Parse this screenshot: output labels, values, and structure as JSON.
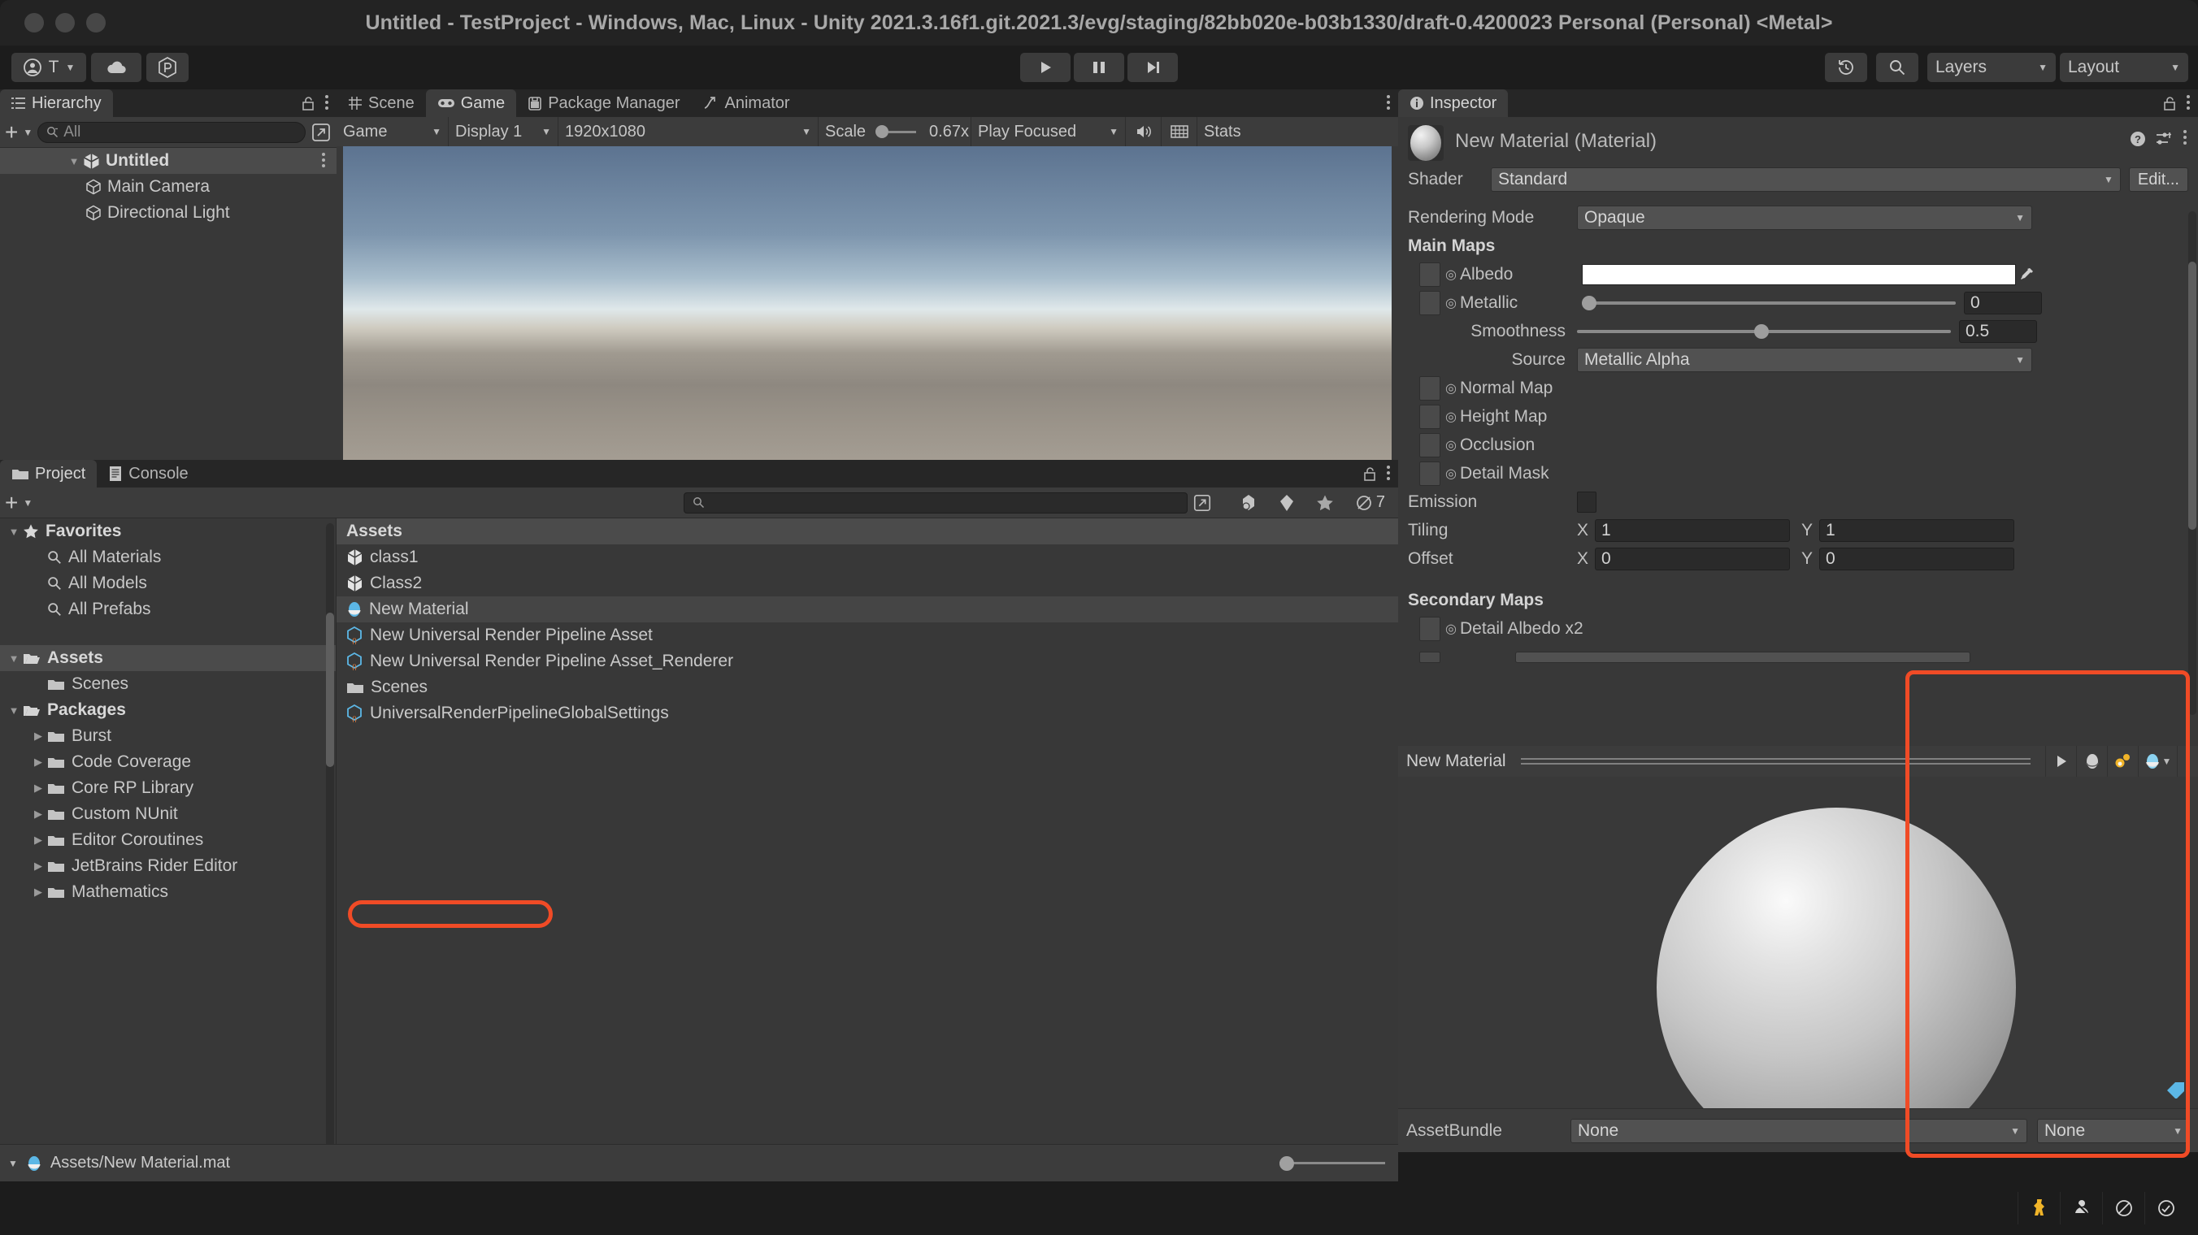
{
  "window": {
    "title": "Untitled - TestProject - Windows, Mac, Linux - Unity 2021.3.16f1.git.2021.3/evg/staging/82bb020e-b03b1330/draft-0.4200023 Personal (Personal) <Metal>"
  },
  "toolbar": {
    "account_label": "T",
    "account_icon": "user-circle-icon",
    "cloud_icon": "cloud-icon",
    "collab_icon": "plastic-scm-icon",
    "play_icon": "play-icon",
    "pause_icon": "pause-icon",
    "step_icon": "step-forward-icon",
    "undo_history_icon": "undo-history-icon",
    "search_icon": "search-icon",
    "layers_label": "Layers",
    "layout_label": "Layout"
  },
  "hierarchy": {
    "tab_label": "Hierarchy",
    "tab_icon": "hierarchy-icon",
    "lock_icon": "lock-open-icon",
    "menu_icon": "kebab-menu-icon",
    "add_label": "+",
    "search_placeholder": "All",
    "search_icon": "search-small-icon",
    "expand_icon": "open-in-new-icon",
    "items": [
      {
        "label": "Untitled",
        "indent": 0,
        "icon": "scene-icon",
        "expanded": true,
        "selected": true,
        "bold": true
      },
      {
        "label": "Main Camera",
        "indent": 1,
        "icon": "gameobject-cube-icon",
        "expanded": false,
        "selected": false,
        "bold": false
      },
      {
        "label": "Directional Light",
        "indent": 1,
        "icon": "gameobject-cube-icon",
        "expanded": false,
        "selected": false,
        "bold": false
      }
    ]
  },
  "gameview": {
    "tabs": [
      {
        "label": "Scene",
        "icon": "scene-grid-icon",
        "active": false
      },
      {
        "label": "Game",
        "icon": "game-pad-icon",
        "active": true
      },
      {
        "label": "Package Manager",
        "icon": "package-icon",
        "active": false
      },
      {
        "label": "Animator",
        "icon": "animator-icon",
        "active": false
      }
    ],
    "menu_icon": "kebab-menu-icon",
    "view_mode": "Game",
    "display": "Display 1",
    "resolution": "1920x1080",
    "scale_label": "Scale",
    "scale_value": "0.67x",
    "play_mode": "Play Focused",
    "mute_icon": "audio-speaker-icon",
    "gizmos_icon": "grid-icon",
    "stats_label": "Stats"
  },
  "inspector": {
    "tab_label": "Inspector",
    "tab_icon": "info-circle-icon",
    "lock_icon": "lock-open-icon",
    "menu_icon": "kebab-menu-icon",
    "asset_title": "New Material (Material)",
    "help_icon": "help-circle-icon",
    "preset_icon": "preset-sliders-icon",
    "shader_label": "Shader",
    "shader_value": "Standard",
    "edit_label": "Edit...",
    "rendering_mode_label": "Rendering Mode",
    "rendering_mode_value": "Opaque",
    "main_maps_label": "Main Maps",
    "albedo_label": "Albedo",
    "albedo_color": "#ffffff",
    "eyedropper_icon": "eyedropper-icon",
    "metallic_label": "Metallic",
    "metallic_value": "0",
    "smoothness_label": "Smoothness",
    "smoothness_value": "0.5",
    "source_label": "Source",
    "source_value": "Metallic Alpha",
    "normal_map_label": "Normal Map",
    "height_map_label": "Height Map",
    "occlusion_label": "Occlusion",
    "detail_mask_label": "Detail Mask",
    "emission_label": "Emission",
    "tiling_label": "Tiling",
    "tiling_x_axis": "X",
    "tiling_x": "1",
    "tiling_y_axis": "Y",
    "tiling_y": "1",
    "offset_label": "Offset",
    "offset_x_axis": "X",
    "offset_x": "0",
    "offset_y_axis": "Y",
    "offset_y": "0",
    "secondary_maps_label": "Secondary Maps",
    "detail_albedo_label": "Detail Albedo x2"
  },
  "material_preview": {
    "name": "New Material",
    "play_icon": "play-icon",
    "shape_icon": "sphere-preview-icon",
    "lighting_icon": "lighting-preview-icon",
    "env_icon": "environment-preview-icon",
    "menu_icon": "kebab-menu-icon",
    "assetbundle_label": "AssetBundle",
    "assetbundle_value": "None",
    "assetbundle_variant": "None"
  },
  "project": {
    "tabs": [
      {
        "label": "Project",
        "icon": "folder-icon",
        "active": true
      },
      {
        "label": "Console",
        "icon": "console-lines-icon",
        "active": false
      }
    ],
    "lock_icon": "lock-open-icon",
    "menu_icon": "kebab-menu-icon",
    "add_label": "+",
    "search_placeholder": "",
    "search_icon": "search-small-icon",
    "expand_icon": "open-in-new-icon",
    "filter_type_icon": "filter-by-type-icon",
    "filter_label_icon": "filter-by-label-icon",
    "favorite_icon": "star-icon",
    "hidden_icon": "hidden-packages-icon",
    "hidden_count": "7",
    "tree": [
      {
        "label": "Favorites",
        "indent": 0,
        "icon": "star-icon",
        "arrow": "down",
        "bold": true,
        "selected": false
      },
      {
        "label": "All Materials",
        "indent": 1,
        "icon": "search-small-icon",
        "arrow": "",
        "bold": false,
        "selected": false
      },
      {
        "label": "All Models",
        "indent": 1,
        "icon": "search-small-icon",
        "arrow": "",
        "bold": false,
        "selected": false
      },
      {
        "label": "All Prefabs",
        "indent": 1,
        "icon": "search-small-icon",
        "arrow": "",
        "bold": false,
        "selected": false
      },
      {
        "label": "",
        "indent": 0,
        "icon": "",
        "arrow": "",
        "bold": false,
        "selected": false
      },
      {
        "label": "Assets",
        "indent": 0,
        "icon": "folder-open-icon",
        "arrow": "down",
        "bold": true,
        "selected": true
      },
      {
        "label": "Scenes",
        "indent": 1,
        "icon": "folder-icon",
        "arrow": "",
        "bold": false,
        "selected": false
      },
      {
        "label": "Packages",
        "indent": 0,
        "icon": "folder-open-icon",
        "arrow": "down",
        "bold": true,
        "selected": false
      },
      {
        "label": "Burst",
        "indent": 1,
        "icon": "folder-icon",
        "arrow": "right",
        "bold": false,
        "selected": false
      },
      {
        "label": "Code Coverage",
        "indent": 1,
        "icon": "folder-icon",
        "arrow": "right",
        "bold": false,
        "selected": false
      },
      {
        "label": "Core RP Library",
        "indent": 1,
        "icon": "folder-icon",
        "arrow": "right",
        "bold": false,
        "selected": false
      },
      {
        "label": "Custom NUnit",
        "indent": 1,
        "icon": "folder-icon",
        "arrow": "right",
        "bold": false,
        "selected": false
      },
      {
        "label": "Editor Coroutines",
        "indent": 1,
        "icon": "folder-icon",
        "arrow": "right",
        "bold": false,
        "selected": false
      },
      {
        "label": "JetBrains Rider Editor",
        "indent": 1,
        "icon": "folder-icon",
        "arrow": "right",
        "bold": false,
        "selected": false
      },
      {
        "label": "Mathematics",
        "indent": 1,
        "icon": "folder-icon",
        "arrow": "right",
        "bold": false,
        "selected": false
      }
    ],
    "assets_header": "Assets",
    "assets": [
      {
        "label": "class1",
        "icon": "cs-script-icon",
        "selected": false
      },
      {
        "label": "Class2",
        "icon": "cs-script-icon",
        "selected": false
      },
      {
        "label": "New Material",
        "icon": "material-icon",
        "selected": true
      },
      {
        "label": "New Universal Render Pipeline Asset",
        "icon": "scriptable-object-icon",
        "selected": false
      },
      {
        "label": "New Universal Render Pipeline Asset_Renderer",
        "icon": "scriptable-object-icon",
        "selected": false
      },
      {
        "label": "Scenes",
        "icon": "folder-icon",
        "selected": false
      },
      {
        "label": "UniversalRenderPipelineGlobalSettings",
        "icon": "scriptable-object-icon",
        "selected": false
      }
    ],
    "status_path": "Assets/New Material.mat",
    "status_icon": "material-icon"
  },
  "bottombar": {
    "icons": [
      "unity-cloud-mascot-icon",
      "collab-icon",
      "no-sound-icon",
      "account-badge-icon"
    ]
  },
  "annotations": {
    "highlight_color": "#f04b26",
    "boxes": [
      "inspector-preview-region",
      "new-material-asset-row"
    ]
  }
}
